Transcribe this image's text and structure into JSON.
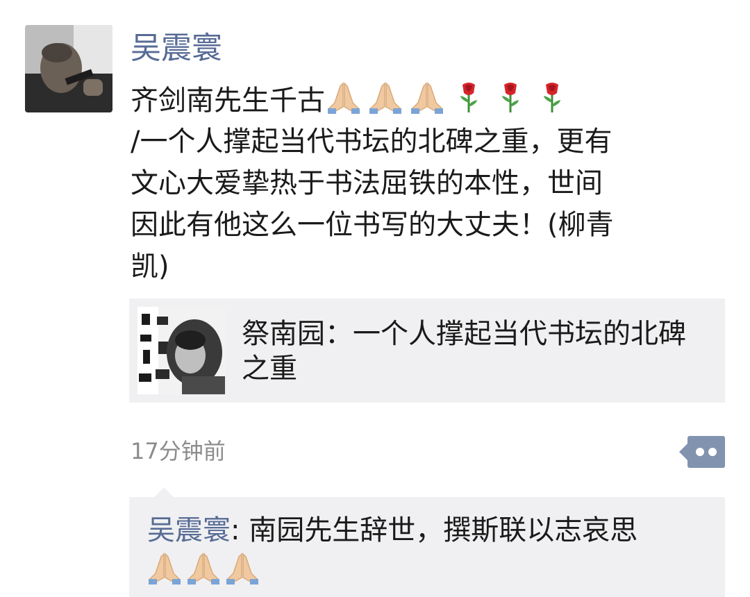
{
  "moment": {
    "author": "吴震寰",
    "text_lines": [
      "齐剑南先生千古",
      "/一个人撑起当代书坛的北碑之重，更有",
      "文心大爱挚热于书法屈铁的本性，世间",
      "因此有他这么一位书写的大丈夫！(柳青",
      "凯)"
    ],
    "emoji_icons": [
      "folded-hands-icon",
      "folded-hands-icon",
      "folded-hands-icon",
      "rose-icon",
      "rose-icon",
      "rose-icon"
    ],
    "link": {
      "title_lines": [
        "祭南园：一个人撑起当代书坛的北碑",
        "之重"
      ]
    },
    "timestamp": "17分钟前",
    "comments": [
      {
        "author": "吴震寰",
        "separator": ": ",
        "text": "南园先生辞世，撰斯联以志哀思",
        "emoji_icons": [
          "folded-hands-icon",
          "folded-hands-icon",
          "folded-hands-icon"
        ]
      }
    ]
  },
  "colors": {
    "name_link": "#576b95",
    "text": "#1a1a1a",
    "meta_gray": "#8c8c8c",
    "card_bg": "#f0f0f2",
    "more_button_bg": "#8193ae"
  }
}
